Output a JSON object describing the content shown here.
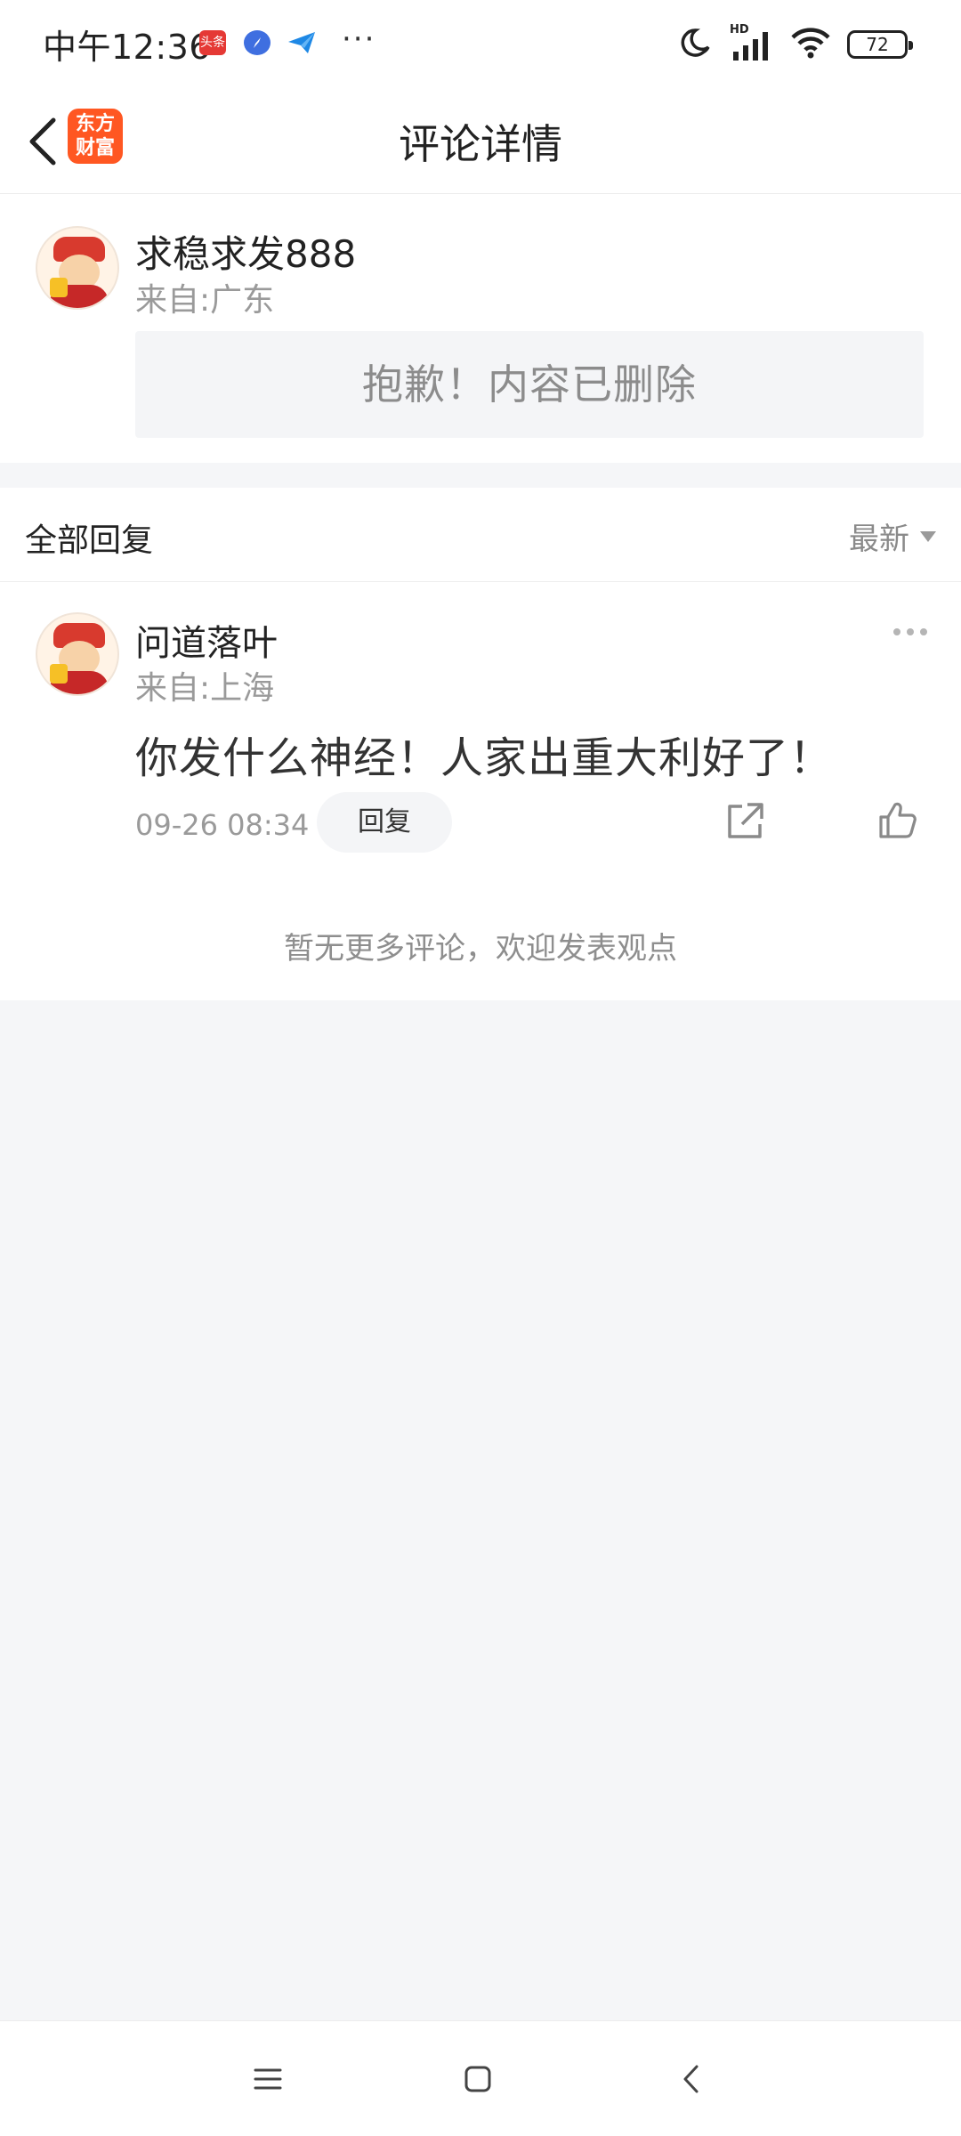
{
  "status_bar": {
    "time": "中午12:36",
    "app_badge_toutiao": "头条",
    "more_indicator": "···",
    "network_label": "HD",
    "battery_level": "72"
  },
  "header": {
    "title": "评论详情",
    "logo_text": "东方财富",
    "logo_color": "#ff5722"
  },
  "main_comment": {
    "username": "求稳求发888",
    "location": "来自:广东",
    "deleted_message": "抱歉！内容已删除"
  },
  "replies_section": {
    "title": "全部回复",
    "sort_label": "最新"
  },
  "replies": [
    {
      "username": "问道落叶",
      "location": "来自:上海",
      "content": "你发什么神经！人家出重大利好了！",
      "time": "09-26 08:34",
      "reply_label": "回复"
    }
  ],
  "footer": {
    "no_more_text": "暂无更多评论，欢迎发表观点"
  },
  "icons": {
    "back": "chevron-left-icon",
    "share": "share-icon",
    "like": "thumbs-up-icon",
    "more": "more-dots-icon"
  }
}
